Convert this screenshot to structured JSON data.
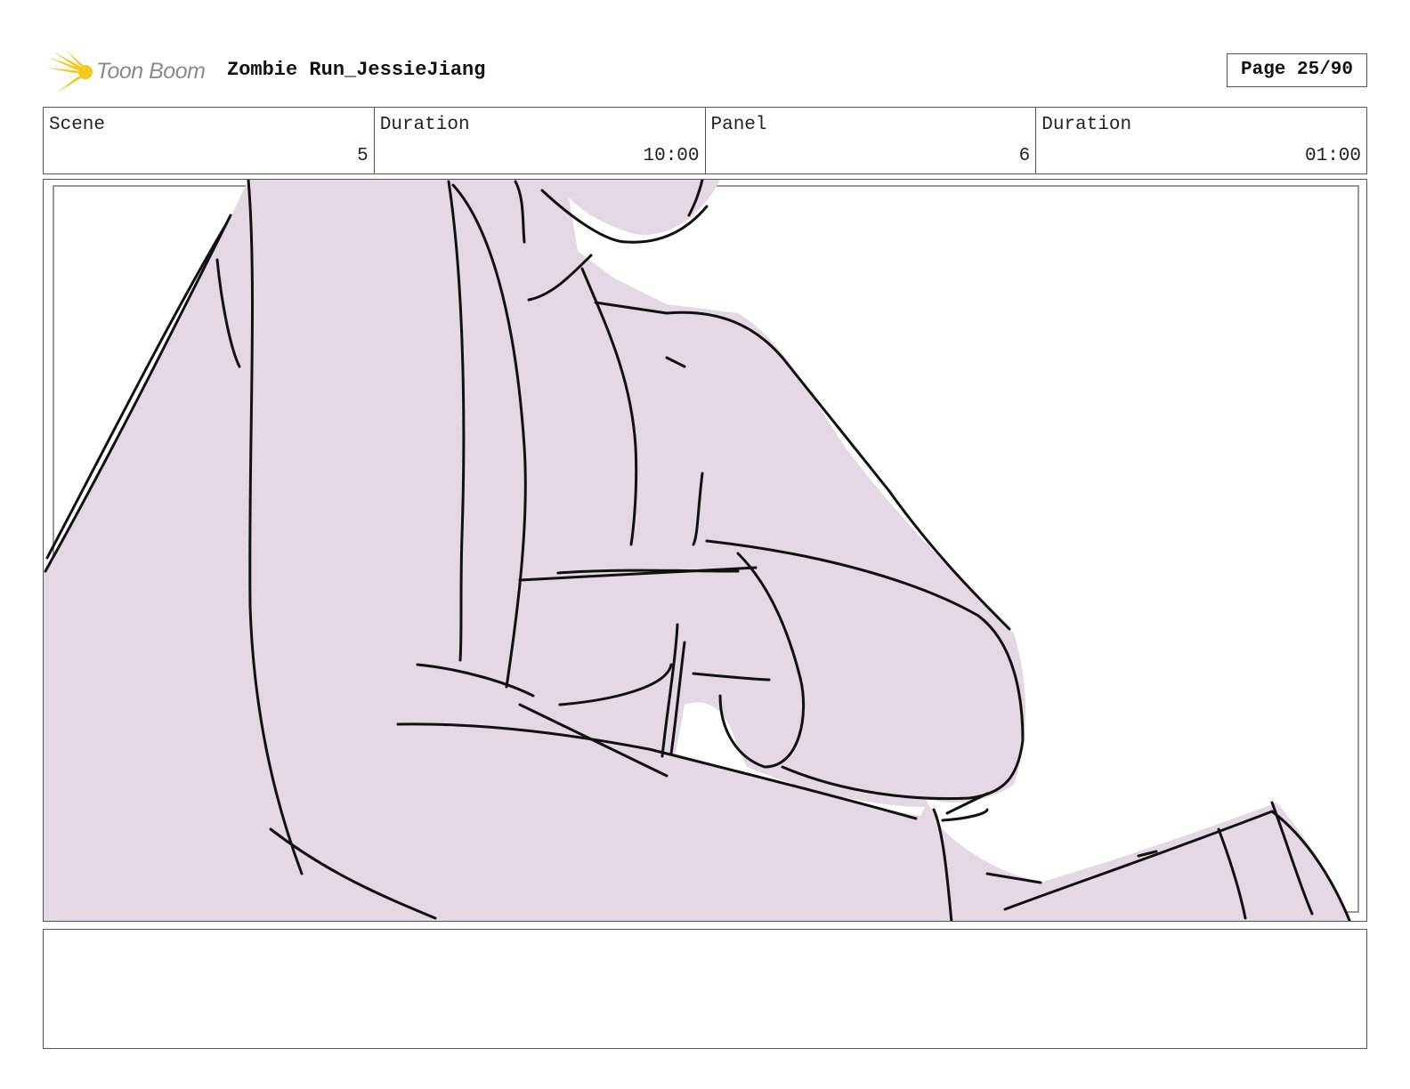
{
  "header": {
    "brand": "Toon Boom",
    "project_title": "Zombie Run_JessieJiang",
    "page_label": "Page 25/90"
  },
  "info": {
    "scene_label": "Scene",
    "scene_value": "5",
    "scene_duration_label": "Duration",
    "scene_duration_value": "10:00",
    "panel_label": "Panel",
    "panel_value": "6",
    "panel_duration_label": "Duration",
    "panel_duration_value": "01:00"
  },
  "colors": {
    "sketch_fill": "#e3d8e3",
    "line": "#111111",
    "logo_yellow": "#f3c91c",
    "border": "#555555"
  },
  "notes": {
    "text": ""
  }
}
